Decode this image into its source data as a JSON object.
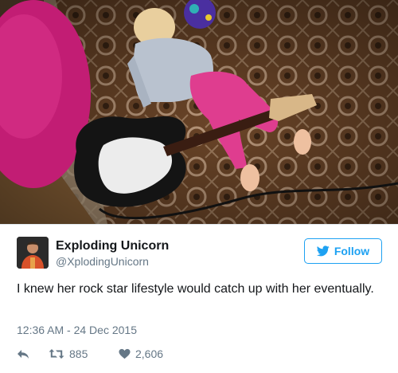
{
  "tweet": {
    "name": "Exploding Unicorn",
    "handle": "@XplodingUnicorn",
    "follow_label": "Follow",
    "text": "I knew her rock star lifestyle would catch up with her eventually.",
    "timestamp": "12:36 AM - 24 Dec 2015",
    "retweets": "885",
    "likes": "2,606"
  },
  "icons": {
    "follow": "twitter-bird-icon",
    "reply": "reply-icon",
    "retweet": "retweet-icon",
    "like": "heart-icon"
  },
  "colors": {
    "accent": "#1da1f2",
    "name": "#14171a",
    "muted": "#657786"
  }
}
